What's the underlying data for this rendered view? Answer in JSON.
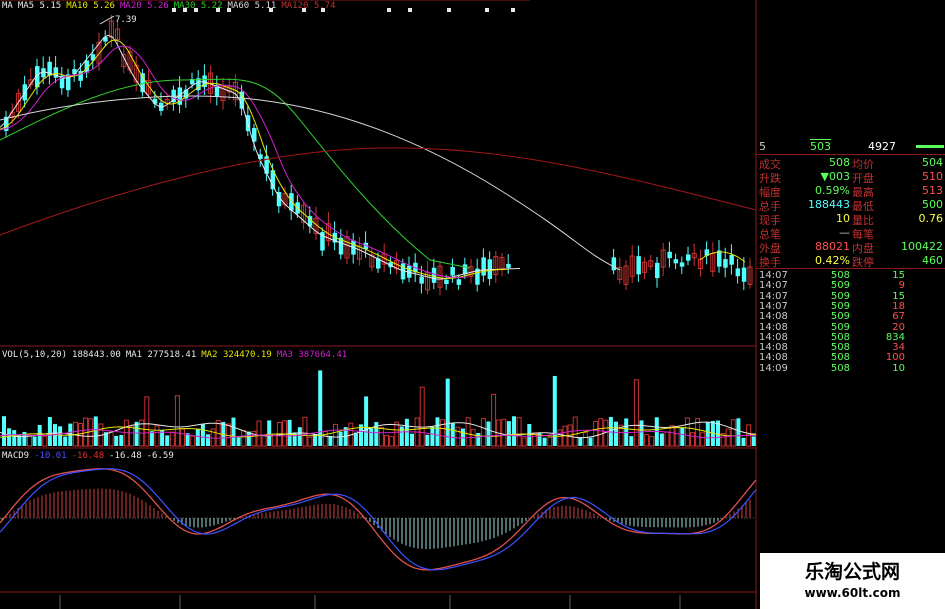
{
  "colors": {
    "up": "#c83232",
    "down": "#54ffff",
    "frame": "#8a1a1a",
    "ma5": "#e8e8e8",
    "ma10": "#e8e800",
    "ma20": "#d020d0",
    "ma30": "#30d030",
    "ma60": "#d8d8d8",
    "ma120": "#a01818",
    "vol_ma1": "#e8e8e8",
    "vol_ma2": "#e8e800",
    "vol_ma3": "#d020d0",
    "dif": "#e8e8e8",
    "dea": "#e8e800",
    "macd_line": "#e8e8e8"
  },
  "ma_legend": [
    {
      "label": "MA",
      "color": "#e8e8e8"
    },
    {
      "label": "MA5 5.15",
      "color": "#e8e8e8"
    },
    {
      "label": "MA10 5.26",
      "color": "#e8e800"
    },
    {
      "label": "MA20 5.26",
      "color": "#d020d0"
    },
    {
      "label": "MA30 5.22",
      "color": "#30d030"
    },
    {
      "label": "MA60 5.11",
      "color": "#d8d8d8"
    },
    {
      "label": "MA120 5.74",
      "color": "#c03030"
    }
  ],
  "price_high_label": "7.39",
  "vol_legend": [
    {
      "label": "VOL(5,10,20)",
      "color": "#e8e8e8"
    },
    {
      "label": "188443.00",
      "color": "#e8e8e8"
    },
    {
      "label": "MA1 277518.41",
      "color": "#e8e8e8"
    },
    {
      "label": "MA2 324470.19",
      "color": "#e8e800"
    },
    {
      "label": "MA3 387664.41",
      "color": "#d020d0"
    }
  ],
  "macd_legend": [
    {
      "label": "MACD9",
      "color": "#e8e8e8"
    },
    {
      "label": "-10.01",
      "color": "#5050ff"
    },
    {
      "label": "-16.48",
      "color": "#e03030"
    },
    {
      "label": "-16.48",
      "color": "#e8e8e8"
    },
    {
      "label": "-6.59",
      "color": "#e8e8e8"
    }
  ],
  "quote_panel": {
    "header": {
      "a": "5",
      "b": "503",
      "c": "4927"
    },
    "rows": [
      {
        "l1": "成交",
        "v1": "508",
        "c1": "#5cff5c",
        "l2": "均价",
        "v2": "504",
        "c2": "#5cff5c"
      },
      {
        "l1": "升跌",
        "v1": "▼003",
        "c1": "#5cff5c",
        "l2": "开盘",
        "v2": "510",
        "c2": "#ff5050"
      },
      {
        "l1": "幅度",
        "v1": "0.59%",
        "c1": "#5cff5c",
        "l2": "最高",
        "v2": "513",
        "c2": "#ff5050"
      },
      {
        "l1": "总手",
        "v1": "188443",
        "c1": "#54ffff",
        "l2": "最低",
        "v2": "500",
        "c2": "#5cff5c"
      },
      {
        "l1": "现手",
        "v1": "10",
        "c1": "#ffff40",
        "l2": "量比",
        "v2": "0.76",
        "c2": "#ffff40"
      },
      {
        "l1": "总笔",
        "v1": "—",
        "c1": "#c8c8c8",
        "l2": "每笔",
        "v2": "",
        "c2": "#c8c8c8"
      },
      {
        "l1": "外盘",
        "v1": "88021",
        "c1": "#ff5050",
        "l2": "内盘",
        "v2": "100422",
        "c2": "#5cff5c"
      },
      {
        "l1": "换手",
        "v1": "0.42%",
        "c1": "#ffff40",
        "l2": "跌停",
        "v2": "460",
        "c2": "#5cff5c"
      }
    ],
    "ticks": [
      {
        "time": "14:07",
        "price": "508",
        "vol": "15",
        "vc": "#5cff5c"
      },
      {
        "time": "14:07",
        "price": "509",
        "vol": "9",
        "vc": "#ff5050"
      },
      {
        "time": "14:07",
        "price": "509",
        "vol": "15",
        "vc": "#5cff5c"
      },
      {
        "time": "14:07",
        "price": "509",
        "vol": "18",
        "vc": "#ff5050"
      },
      {
        "time": "14:08",
        "price": "509",
        "vol": "67",
        "vc": "#ff5050"
      },
      {
        "time": "14:08",
        "price": "509",
        "vol": "20",
        "vc": "#ff5050"
      },
      {
        "time": "14:08",
        "price": "508",
        "vol": "834",
        "vc": "#5cff5c"
      },
      {
        "time": "14:08",
        "price": "508",
        "vol": "34",
        "vc": "#ff5050"
      },
      {
        "time": "14:08",
        "price": "508",
        "vol": "100",
        "vc": "#ff5050"
      },
      {
        "time": "14:09",
        "price": "508",
        "vol": "10",
        "vc": "#5cff5c"
      }
    ]
  },
  "watermark": {
    "title": "乐淘公式网",
    "url": "www.60lt.com"
  }
}
